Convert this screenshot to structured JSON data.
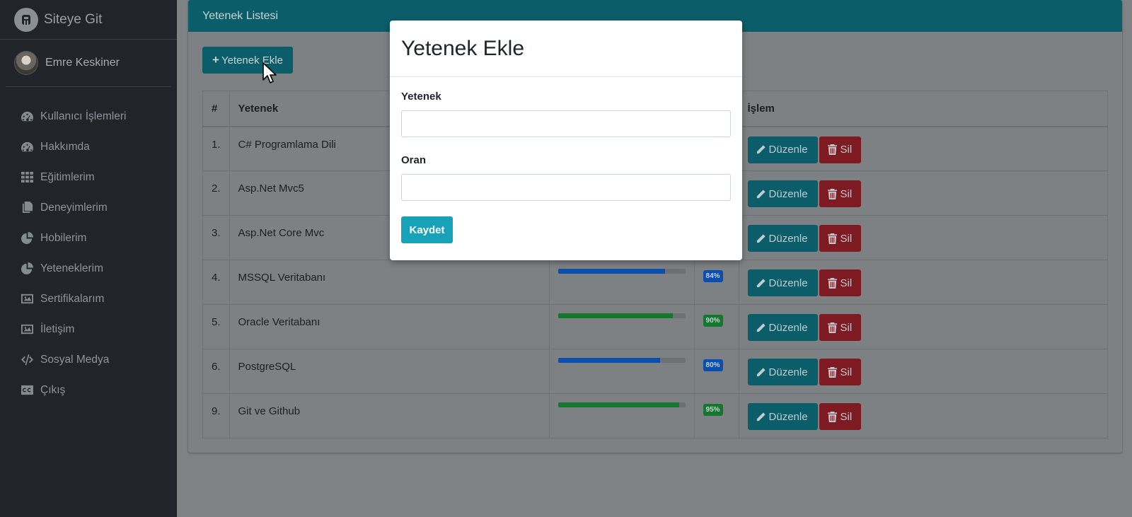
{
  "brand": {
    "title": "Siteye Git"
  },
  "user": {
    "name": "Emre Keskiner"
  },
  "sidebar": {
    "items": [
      {
        "label": "Kullanıcı İşlemleri",
        "icon": "dashboard-icon"
      },
      {
        "label": "Hakkımda",
        "icon": "dashboard-icon"
      },
      {
        "label": "Eğitimlerim",
        "icon": "grid-icon"
      },
      {
        "label": "Deneyimlerim",
        "icon": "copy-icon"
      },
      {
        "label": "Hobilerim",
        "icon": "pie-chart-icon"
      },
      {
        "label": "Yeteneklerim",
        "icon": "pie-chart-icon"
      },
      {
        "label": "Sertifikalarım",
        "icon": "image-icon"
      },
      {
        "label": "İletişim",
        "icon": "image-icon"
      },
      {
        "label": "Sosyal Medya",
        "icon": "code-icon"
      },
      {
        "label": "Çıkış",
        "icon": "cc-icon"
      }
    ]
  },
  "card": {
    "title": "Yetenek Listesi",
    "add_label": "Yetenek Ekle"
  },
  "table": {
    "headers": {
      "num": "#",
      "name": "Yetenek",
      "ops": "İşlem"
    },
    "edit_label": "Düzenle",
    "delete_label": "Sil",
    "rows": [
      {
        "num": "1.",
        "name": "C# Programlama Dili",
        "percent": null,
        "percent_label": "",
        "color": "#0a4fb0"
      },
      {
        "num": "2.",
        "name": "Asp.Net Mvc5",
        "percent": null,
        "percent_label": "",
        "color": "#0a4fb0"
      },
      {
        "num": "3.",
        "name": "Asp.Net Core Mvc",
        "percent": null,
        "percent_label": "",
        "color": "#0a4fb0"
      },
      {
        "num": "4.",
        "name": "MSSQL Veritabanı",
        "percent": 84,
        "percent_label": "84%",
        "color": "#0a4fb0"
      },
      {
        "num": "5.",
        "name": "Oracle Veritabanı",
        "percent": 90,
        "percent_label": "90%",
        "color": "#15762e"
      },
      {
        "num": "6.",
        "name": "PostgreSQL",
        "percent": 80,
        "percent_label": "80%",
        "color": "#0a4fb0"
      },
      {
        "num": "9.",
        "name": "Git ve Github",
        "percent": 95,
        "percent_label": "95%",
        "color": "#15762e"
      }
    ]
  },
  "modal": {
    "title": "Yetenek Ekle",
    "skill_label": "Yetenek",
    "skill_value": "",
    "rate_label": "Oran",
    "rate_value": "",
    "save_label": "Kaydet"
  }
}
